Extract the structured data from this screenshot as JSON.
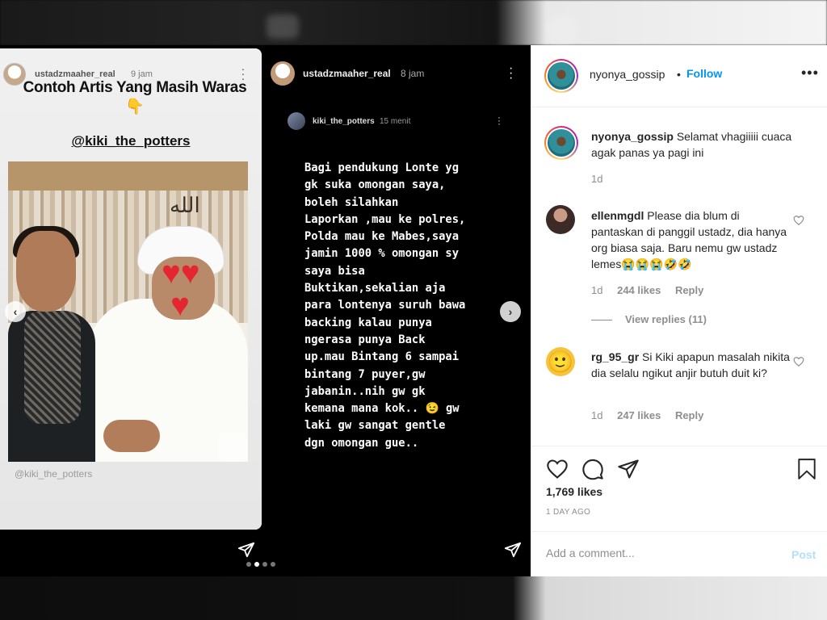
{
  "left_story": {
    "username": "ustadzmaaher_real",
    "time": "9 jam",
    "title": "Contoh Artis Yang Masih Waras",
    "pointing_emoji": "👇",
    "handle": "@kiki_the_potters",
    "photo_arabic": "الله",
    "credit": "@kiki_the_potters"
  },
  "right_story": {
    "username": "ustadzmaaher_real",
    "time": "8 jam",
    "inner_username": "kiki_the_potters",
    "inner_time": "15 menit",
    "text": "Bagi pendukung Lonte yg\ngk suka omongan saya,\nboleh silahkan\nLaporkan ,mau ke polres,\nPolda mau ke Mabes,saya\njamin 1000 % omongan sy\nsaya bisa\nBuktikan,sekalian aja\npara lontenya suruh bawa\nbacking kalau punya\nngerasa punya Back\nup.mau Bintang 6 sampai\nbintang 7 puyer,gw\njabanin..nih gw gk\nkemana mana kok.. 😉 gw\nlaki gw sangat gentle\ndgn omongan gue.."
  },
  "navigation": {
    "prev_icon": "chevron-left-icon",
    "next_icon": "chevron-right-icon",
    "prev_glyph": "‹",
    "next_glyph": "›"
  },
  "pager": {
    "count": 4,
    "active": 1
  },
  "header": {
    "username": "nyonya_gossip",
    "separator": "•",
    "follow_label": "Follow",
    "more_label": "•••"
  },
  "comments": [
    {
      "username": "nyonya_gossip",
      "text": "Selamat vhagiiiii cuaca agak panas ya pagi ini",
      "time": "1d"
    },
    {
      "username": "ellenmgdl",
      "text": "Please dia blum di pantaskan di panggil ustadz, dia hanya org biasa saja. Baru nemu gw ustadz lemes😭😭😭🤣🤣",
      "time": "1d",
      "likes": "244 likes",
      "reply_label": "Reply",
      "view_replies": "View replies (11)"
    },
    {
      "username": "rg_95_gr",
      "text": "Si Kiki apapun masalah nikita dia selalu ngikut anjir butuh duit ki?",
      "time": "1d",
      "likes": "247 likes",
      "reply_label": "Reply",
      "avatar_emoji": "🙂"
    }
  ],
  "actions": {
    "likes": "1,769 likes",
    "posted": "1 DAY AGO"
  },
  "add_comment": {
    "placeholder": "Add a comment...",
    "post_label": "Post"
  },
  "colors": {
    "accent": "#0095f6",
    "post_disabled": "#b2dffc",
    "muted_text": "#8e8e8e",
    "primary_text": "#262626"
  }
}
